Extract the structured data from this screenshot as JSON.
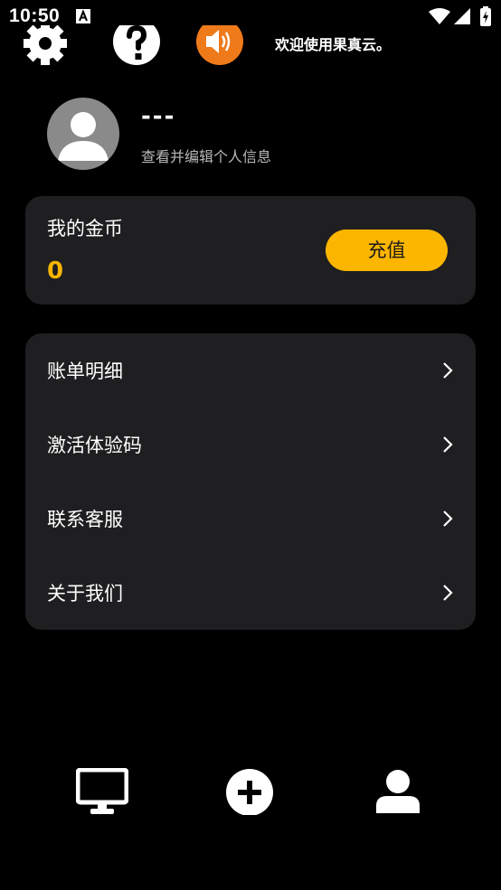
{
  "status_bar": {
    "time": "10:50"
  },
  "header": {
    "welcome": "欢迎使用果真云。",
    "icons": [
      "gear-icon",
      "help-icon",
      "speaker-icon"
    ],
    "speaker_color": "#ef7a1a"
  },
  "profile": {
    "name": "---",
    "subtitle": "查看并编辑个人信息"
  },
  "coins": {
    "title": "我的金币",
    "value": "0",
    "recharge_label": "充值",
    "accent": "#fcb600"
  },
  "menu": {
    "items": [
      {
        "label": "账单明细"
      },
      {
        "label": "激活体验码"
      },
      {
        "label": "联系客服"
      },
      {
        "label": "关于我们"
      }
    ]
  },
  "bottom_nav": {
    "items": [
      "monitor-icon",
      "add-icon",
      "user-icon"
    ]
  }
}
